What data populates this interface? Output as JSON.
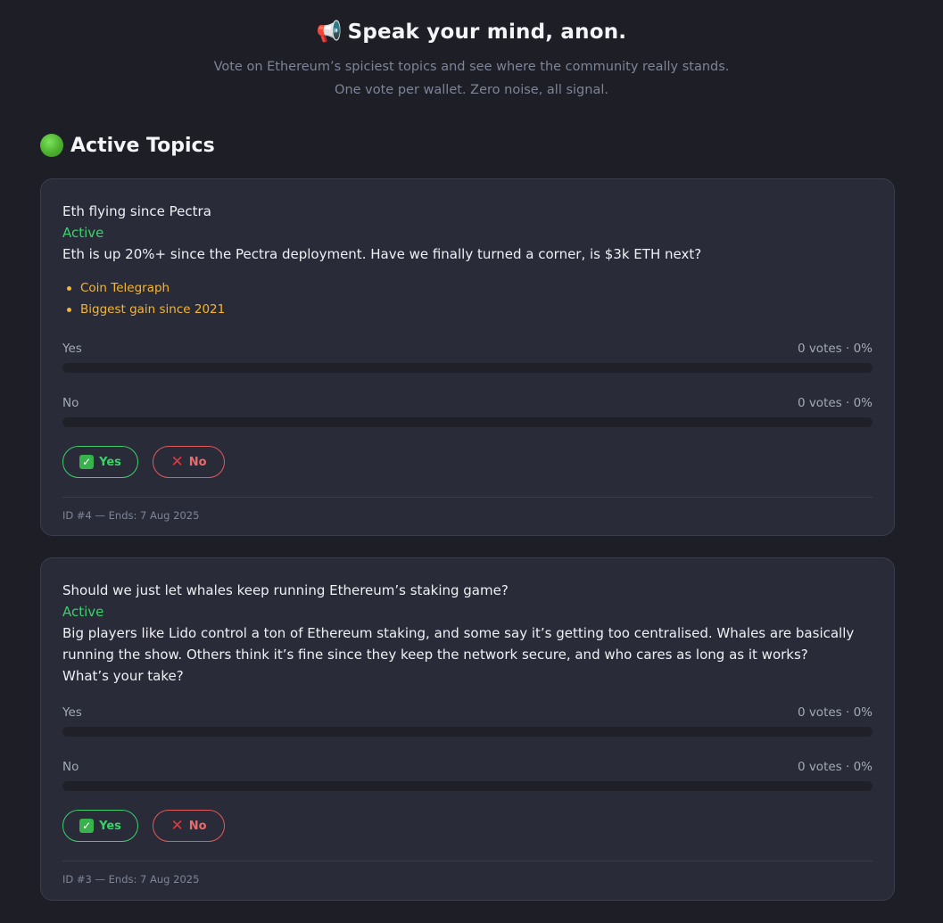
{
  "header": {
    "title": "Speak your mind, anon.",
    "title_icon": "megaphone-icon",
    "subtitle_line1": "Vote on Ethereum’s spiciest topics and see where the community really stands.",
    "subtitle_line2": "One vote per wallet. Zero noise, all signal."
  },
  "section": {
    "title": "Active Topics",
    "icon": "green-circle-icon"
  },
  "colors": {
    "background": "#1d1e26",
    "card": "#292b38",
    "active": "#3ccf6b",
    "link": "#f5b52e",
    "no": "#e05a5a"
  },
  "topics": [
    {
      "title": "Eth flying since Pectra",
      "status": "Active",
      "description": "Eth is up 20%+ since the Pectra deployment. Have we finally turned a corner, is $3k ETH next?",
      "links": [
        "Coin Telegraph",
        "Biggest gain since 2021"
      ],
      "options": [
        {
          "label": "Yes",
          "stats": "0 votes · 0%",
          "percent": 0
        },
        {
          "label": "No",
          "stats": "0 votes · 0%",
          "percent": 0
        }
      ],
      "yes_label": "Yes",
      "no_label": "No",
      "meta": "ID #4 — Ends: 7 Aug 2025"
    },
    {
      "title": "Should we just let whales keep running Ethereum’s staking game?",
      "status": "Active",
      "description_lines": [
        "Big players like Lido control a ton of Ethereum staking, and some say it’s getting too centralised. Whales are basically",
        "running the show. Others think it’s fine since they keep the network secure, and who cares as long as it works?",
        "What’s your take?"
      ],
      "options": [
        {
          "label": "Yes",
          "stats": "0 votes · 0%",
          "percent": 0
        },
        {
          "label": "No",
          "stats": "0 votes · 0%",
          "percent": 0
        }
      ],
      "yes_label": "Yes",
      "no_label": "No",
      "meta": "ID #3 — Ends: 7 Aug 2025"
    }
  ]
}
